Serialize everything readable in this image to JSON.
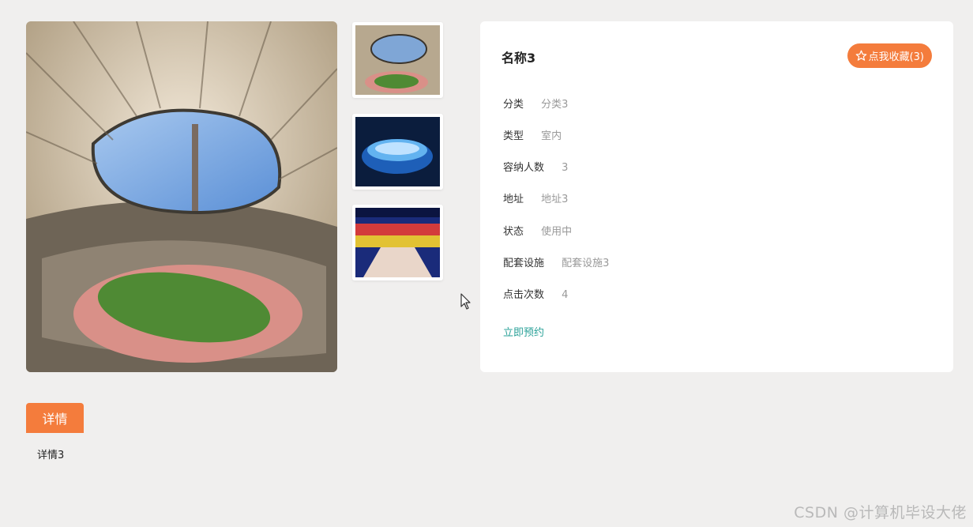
{
  "main_image": {
    "alt": "stadium"
  },
  "thumbnails": [
    {
      "alt": "stadium-thumb"
    },
    {
      "alt": "arena-night-thumb"
    },
    {
      "alt": "indoor-court-thumb"
    }
  ],
  "info": {
    "title": "名称3",
    "favorite_label": "点我收藏(3)",
    "rows": [
      {
        "label": "分类",
        "value": "分类3"
      },
      {
        "label": "类型",
        "value": "室内"
      },
      {
        "label": "容纳人数",
        "value": "3"
      },
      {
        "label": "地址",
        "value": "地址3"
      },
      {
        "label": "状态",
        "value": "使用中"
      },
      {
        "label": "配套设施",
        "value": "配套设施3"
      },
      {
        "label": "点击次数",
        "value": "4"
      }
    ],
    "book_label": "立即预约"
  },
  "tabs": {
    "details_label": "详情"
  },
  "details": {
    "content": "详情3"
  },
  "watermark": "CSDN @计算机毕设大佬",
  "colors": {
    "accent": "#f47c3c",
    "link": "#2aa198",
    "background": "#f0efee"
  }
}
